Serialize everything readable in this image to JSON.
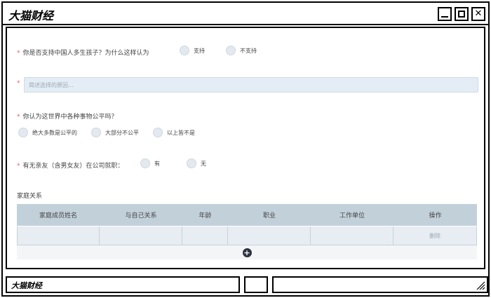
{
  "window": {
    "title": "大猫财经"
  },
  "form": {
    "q1": {
      "text": "你是否支持中国人多生孩子？为什么这样认为",
      "options": [
        "支持",
        "不支持"
      ]
    },
    "reason": {
      "placeholder": "简述选择的原因..."
    },
    "q2": {
      "text": "你认为这世界中各种事物公平吗？",
      "options": [
        "绝大多数是公平的",
        "大部分不公平",
        "以上皆不是"
      ]
    },
    "q3": {
      "text": "有无亲友（含男女友）在公司就职：",
      "options": [
        "有",
        "无"
      ]
    }
  },
  "family": {
    "label": "家庭关系",
    "headers": [
      "家庭成员姓名",
      "与自己关系",
      "年龄",
      "职业",
      "工作单位",
      "操作"
    ],
    "rows": [
      {
        "action": "删除"
      }
    ]
  },
  "statusbar": {
    "text": "大猫财经"
  }
}
